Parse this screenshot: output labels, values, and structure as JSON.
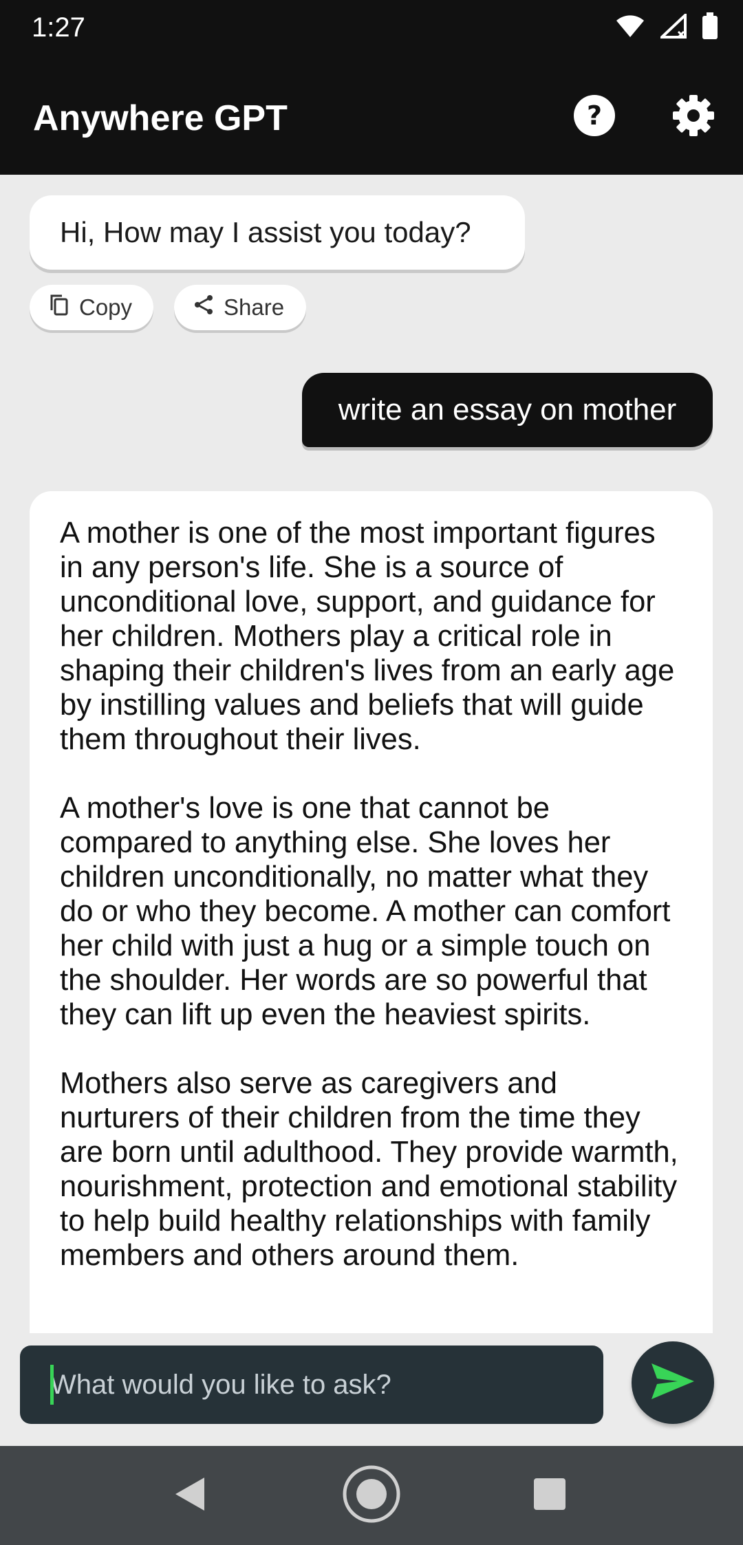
{
  "status": {
    "time": "1:27",
    "icons": [
      "wifi-icon",
      "signal-icon",
      "battery-icon"
    ]
  },
  "app": {
    "title": "Anywhere GPT",
    "help_icon": "help-circle-icon",
    "settings_icon": "gear-icon"
  },
  "chat": {
    "bot_greeting": "Hi, How may I assist you today?",
    "actions": {
      "copy": "Copy",
      "share": "Share"
    },
    "user_message": "write an essay on mother",
    "response_paragraphs": [
      "A mother is one of the most important figures in any person's life. She is a source of unconditional love, support, and guidance for her children. Mothers play a critical role in shaping their children's lives from an early age by instilling values and beliefs that will guide them throughout their lives.",
      "A mother's love is one that cannot be compared to anything else. She loves her children unconditionally, no matter what they do or who they become. A mother can comfort her child with just a hug or a simple touch on the shoulder. Her words are so powerful that they can lift up even the heaviest spirits.",
      "Mothers also serve as caregivers and nurturers of their children from the time they are born until adulthood. They provide warmth, nourishment, protection and emotional stability to help build healthy relationships with family members and others around them."
    ]
  },
  "input": {
    "placeholder": "What would you like to ask?",
    "send_icon": "send-icon"
  },
  "colors": {
    "bar": "#111111",
    "input_bg": "#263238",
    "send_accent": "#38d457"
  }
}
